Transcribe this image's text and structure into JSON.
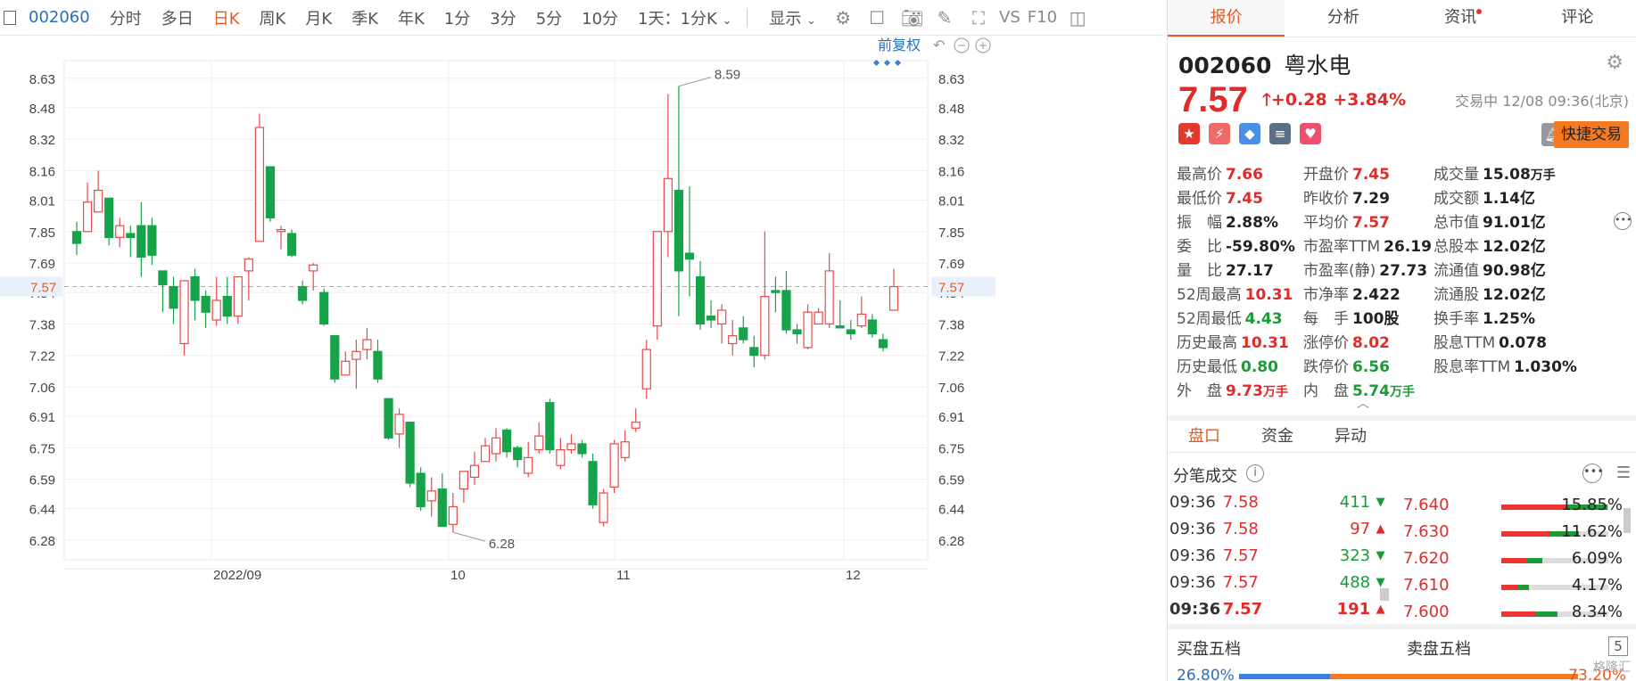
{
  "toolbar": {
    "code": "002060",
    "items": [
      "分时",
      "多日",
      "日K",
      "周K",
      "月K",
      "季K",
      "年K",
      "1分",
      "3分",
      "5分",
      "10分"
    ],
    "active_item": "日K",
    "period_select": "1天：1分K",
    "display": "显示",
    "vs": "VS",
    "f10": "F10"
  },
  "chart_controls": {
    "adjust": "前复权"
  },
  "chart_data": {
    "type": "candlestick",
    "y_ticks": [
      "8.63",
      "8.48",
      "8.32",
      "8.16",
      "8.01",
      "7.85",
      "7.69",
      "7.54",
      "7.38",
      "7.22",
      "7.06",
      "6.91",
      "6.75",
      "6.59",
      "6.44",
      "6.28"
    ],
    "ylim": [
      6.18,
      8.72
    ],
    "x_labels": [
      "2022/09",
      "10",
      "11",
      "12"
    ],
    "last_price_label": "7.57",
    "max_annotation": "8.59",
    "min_annotation": "6.28",
    "candles": [
      [
        7.85,
        7.79,
        7.9,
        7.73
      ],
      [
        7.85,
        8.0,
        8.1,
        7.85
      ],
      [
        7.95,
        8.06,
        8.16,
        7.95
      ],
      [
        8.02,
        7.82,
        8.02,
        7.78
      ],
      [
        7.82,
        7.88,
        7.92,
        7.77
      ],
      [
        7.84,
        7.82,
        7.88,
        7.72
      ],
      [
        7.88,
        7.72,
        8.0,
        7.62
      ],
      [
        7.88,
        7.73,
        7.92,
        7.68
      ],
      [
        7.65,
        7.58,
        7.65,
        7.44
      ],
      [
        7.57,
        7.46,
        7.62,
        7.38
      ],
      [
        7.28,
        7.6,
        7.6,
        7.22
      ],
      [
        7.62,
        7.5,
        7.66,
        7.4
      ],
      [
        7.52,
        7.44,
        7.55,
        7.36
      ],
      [
        7.4,
        7.5,
        7.62,
        7.37
      ],
      [
        7.52,
        7.42,
        7.62,
        7.38
      ],
      [
        7.42,
        7.62,
        7.62,
        7.38
      ],
      [
        7.65,
        7.71,
        7.72,
        7.5
      ],
      [
        7.8,
        8.38,
        8.45,
        7.8
      ],
      [
        8.18,
        7.92,
        8.18,
        7.9
      ],
      [
        7.85,
        7.86,
        7.88,
        7.76
      ],
      [
        7.84,
        7.73,
        7.86,
        7.72
      ],
      [
        7.57,
        7.5,
        7.6,
        7.48
      ],
      [
        7.65,
        7.68,
        7.69,
        7.55
      ],
      [
        7.54,
        7.38,
        7.56,
        7.37
      ],
      [
        7.32,
        7.1,
        7.32,
        7.08
      ],
      [
        7.12,
        7.19,
        7.24,
        7.12
      ],
      [
        7.2,
        7.24,
        7.3,
        7.05
      ],
      [
        7.25,
        7.3,
        7.36,
        7.2
      ],
      [
        7.24,
        7.1,
        7.3,
        7.08
      ],
      [
        7.0,
        6.8,
        7.0,
        6.79
      ],
      [
        6.82,
        6.92,
        6.95,
        6.75
      ],
      [
        6.88,
        6.57,
        6.88,
        6.55
      ],
      [
        6.62,
        6.45,
        6.65,
        6.43
      ],
      [
        6.48,
        6.53,
        6.6,
        6.4
      ],
      [
        6.54,
        6.35,
        6.62,
        6.35
      ],
      [
        6.36,
        6.45,
        6.52,
        6.32
      ],
      [
        6.54,
        6.63,
        6.63,
        6.47
      ],
      [
        6.6,
        6.66,
        6.73,
        6.56
      ],
      [
        6.68,
        6.76,
        6.8,
        6.68
      ],
      [
        6.72,
        6.8,
        6.85,
        6.68
      ],
      [
        6.84,
        6.73,
        6.85,
        6.7
      ],
      [
        6.75,
        6.69,
        6.76,
        6.65
      ],
      [
        6.62,
        6.7,
        6.78,
        6.6
      ],
      [
        6.74,
        6.81,
        6.88,
        6.72
      ],
      [
        6.98,
        6.74,
        7.0,
        6.72
      ],
      [
        6.66,
        6.74,
        6.8,
        6.64
      ],
      [
        6.74,
        6.77,
        6.82,
        6.72
      ],
      [
        6.77,
        6.72,
        6.79,
        6.7
      ],
      [
        6.68,
        6.46,
        6.72,
        6.44
      ],
      [
        6.37,
        6.52,
        6.54,
        6.35
      ],
      [
        6.55,
        6.77,
        6.79,
        6.52
      ],
      [
        6.7,
        6.78,
        6.84,
        6.68
      ],
      [
        6.85,
        6.88,
        6.95,
        6.83
      ],
      [
        7.05,
        7.25,
        7.3,
        7.0
      ],
      [
        7.37,
        7.85,
        7.6,
        7.3
      ],
      [
        7.85,
        8.12,
        8.55,
        7.72
      ],
      [
        8.06,
        7.65,
        8.59,
        7.42
      ],
      [
        7.74,
        7.71,
        8.08,
        7.52
      ],
      [
        7.62,
        7.38,
        7.7,
        7.35
      ],
      [
        7.42,
        7.4,
        7.5,
        7.36
      ],
      [
        7.38,
        7.45,
        7.48,
        7.28
      ],
      [
        7.28,
        7.32,
        7.4,
        7.22
      ],
      [
        7.36,
        7.3,
        7.42,
        7.28
      ],
      [
        7.26,
        7.22,
        7.32,
        7.16
      ],
      [
        7.22,
        7.52,
        7.85,
        7.2
      ],
      [
        7.55,
        7.54,
        7.62,
        7.44
      ],
      [
        7.55,
        7.35,
        7.65,
        7.33
      ],
      [
        7.35,
        7.33,
        7.38,
        7.28
      ],
      [
        7.26,
        7.44,
        7.48,
        7.25
      ],
      [
        7.38,
        7.44,
        7.46,
        7.38
      ],
      [
        7.38,
        7.65,
        7.74,
        7.36
      ],
      [
        7.37,
        7.36,
        7.5,
        7.36
      ],
      [
        7.35,
        7.33,
        7.4,
        7.3
      ],
      [
        7.37,
        7.43,
        7.52,
        7.36
      ],
      [
        7.4,
        7.33,
        7.43,
        7.31
      ],
      [
        7.3,
        7.26,
        7.33,
        7.24
      ],
      [
        7.45,
        7.57,
        7.66,
        7.45
      ]
    ]
  },
  "tabs": [
    "报价",
    "分析",
    "资讯",
    "评论"
  ],
  "active_tab": "报价",
  "quote": {
    "code": "002060",
    "name": "粤水电",
    "price": "7.57",
    "change": "+0.28",
    "change_pct": "+3.84%",
    "status": "交易中 12/08 09:36(北京)",
    "quick_trade": "快捷交易"
  },
  "stats": [
    [
      [
        "最高价",
        "7.66",
        "red"
      ],
      [
        "开盘价",
        "7.45",
        "red"
      ],
      [
        "成交量",
        "15.08",
        "",
        "万手"
      ]
    ],
    [
      [
        "最低价",
        "7.45",
        "red"
      ],
      [
        "昨收价",
        "7.29",
        ""
      ],
      [
        "成交额",
        "1.14亿",
        ""
      ]
    ],
    [
      [
        "振　幅",
        "2.88%",
        ""
      ],
      [
        "平均价",
        "7.57",
        "red"
      ],
      [
        "总市值",
        "91.01亿",
        ""
      ]
    ],
    [
      [
        "委　比",
        "-59.80%",
        ""
      ],
      [
        "市盈率TTM",
        "26.19",
        ""
      ],
      [
        "总股本",
        "12.02亿",
        ""
      ]
    ],
    [
      [
        "量　比",
        "27.17",
        ""
      ],
      [
        "市盈率(静)",
        "27.73",
        ""
      ],
      [
        "流通值",
        "90.98亿",
        ""
      ]
    ],
    [
      [
        "52周最高",
        "10.31",
        "red"
      ],
      [
        "市净率",
        "2.422",
        ""
      ],
      [
        "流通股",
        "12.02亿",
        ""
      ]
    ],
    [
      [
        "52周最低",
        "4.43",
        "green"
      ],
      [
        "每　手",
        "100股",
        ""
      ],
      [
        "换手率",
        "1.25%",
        ""
      ]
    ],
    [
      [
        "历史最高",
        "10.31",
        "red"
      ],
      [
        "涨停价",
        "8.02",
        "red"
      ],
      [
        "股息TTM",
        "0.078",
        ""
      ]
    ],
    [
      [
        "历史最低",
        "0.80",
        "green"
      ],
      [
        "跌停价",
        "6.56",
        "green"
      ],
      [
        "股息率TTM",
        "1.030%",
        ""
      ]
    ],
    [
      [
        "外　盘",
        "9.73",
        "red",
        "万手"
      ],
      [
        "内　盘",
        "5.74",
        "green",
        "万手"
      ]
    ]
  ],
  "sub_tabs": [
    "盘口",
    "资金",
    "异动"
  ],
  "active_sub_tab": "盘口",
  "ticks_title": "分笔成交",
  "ticks": [
    [
      "09:36",
      "7.58",
      "411",
      "down"
    ],
    [
      "09:36",
      "7.58",
      "97",
      "up"
    ],
    [
      "09:36",
      "7.57",
      "323",
      "down"
    ],
    [
      "09:36",
      "7.57",
      "488",
      "down"
    ],
    [
      "09:36",
      "7.57",
      "191",
      "up"
    ]
  ],
  "distribution": [
    [
      "7.640",
      "15.85%"
    ],
    [
      "7.630",
      "11.62%"
    ],
    [
      "7.620",
      "6.09%"
    ],
    [
      "7.610",
      "4.17%"
    ],
    [
      "7.600",
      "8.34%"
    ]
  ],
  "book": {
    "buy_label": "买盘五档",
    "sell_label": "卖盘五档",
    "five": "5",
    "buy_pct": "26.80%",
    "sell_pct": "73.20%",
    "buy_ratio": 0.268
  },
  "watermark": "格隆汇"
}
